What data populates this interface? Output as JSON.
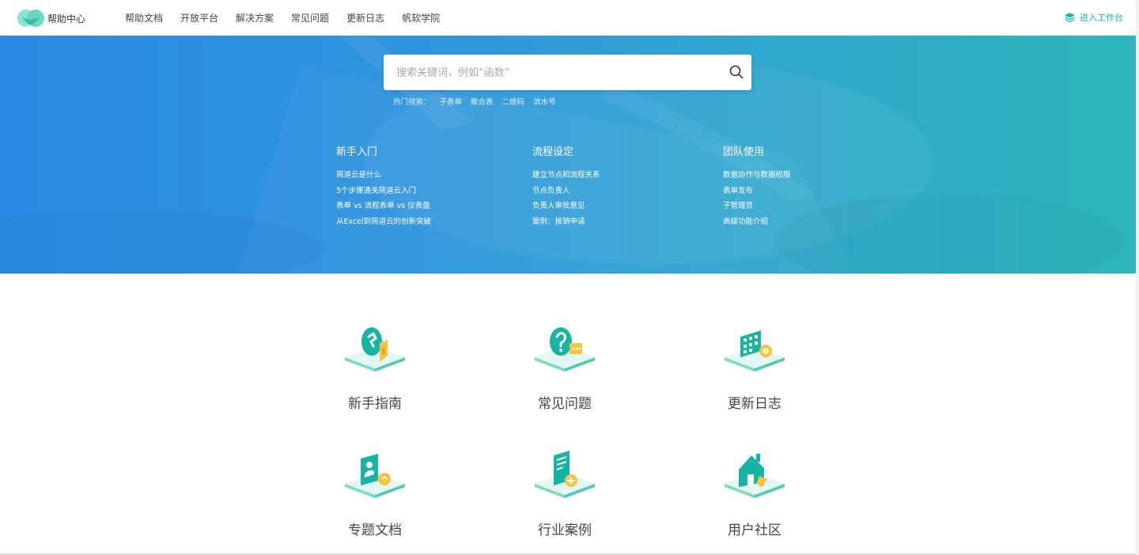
{
  "header": {
    "logo_text": "帮助中心",
    "nav": [
      "帮助文档",
      "开放平台",
      "解决方案",
      "常见问题",
      "更新日志",
      "帆软学院"
    ],
    "workbench_label": "进入工作台"
  },
  "search": {
    "placeholder": "搜索关键词，例如“函数”",
    "hot_label": "热门搜索：",
    "hot_keywords": [
      "子表单",
      "聚合表",
      "二维码",
      "流水号"
    ]
  },
  "columns": [
    {
      "title": "新手入门",
      "links": [
        "简道云是什么",
        "5个步骤通关简道云入门",
        "表单 vs 流程表单 vs 仪表盘",
        "从Excel到简道云的创新突破"
      ]
    },
    {
      "title": "流程设定",
      "links": [
        "建立节点和流程关系",
        "节点负责人",
        "负责人审批意见",
        "案例：报销申请"
      ]
    },
    {
      "title": "团队使用",
      "links": [
        "数据协作与数据权限",
        "表单发布",
        "子管理员",
        "高级功能介绍"
      ]
    }
  ],
  "cards": [
    {
      "label": "新手指南",
      "icon": "guide-icon"
    },
    {
      "label": "常见问题",
      "icon": "faq-icon"
    },
    {
      "label": "更新日志",
      "icon": "calendar-icon"
    },
    {
      "label": "专题文档",
      "icon": "document-icon"
    },
    {
      "label": "行业案例",
      "icon": "case-icon"
    },
    {
      "label": "用户社区",
      "icon": "community-icon"
    }
  ],
  "colors": {
    "accent": "#1fb3a8",
    "hero_start": "#2b8ae4",
    "hero_end": "#2eb6ba",
    "icon_teal": "#17b3a3",
    "icon_yellow": "#f5c242"
  }
}
